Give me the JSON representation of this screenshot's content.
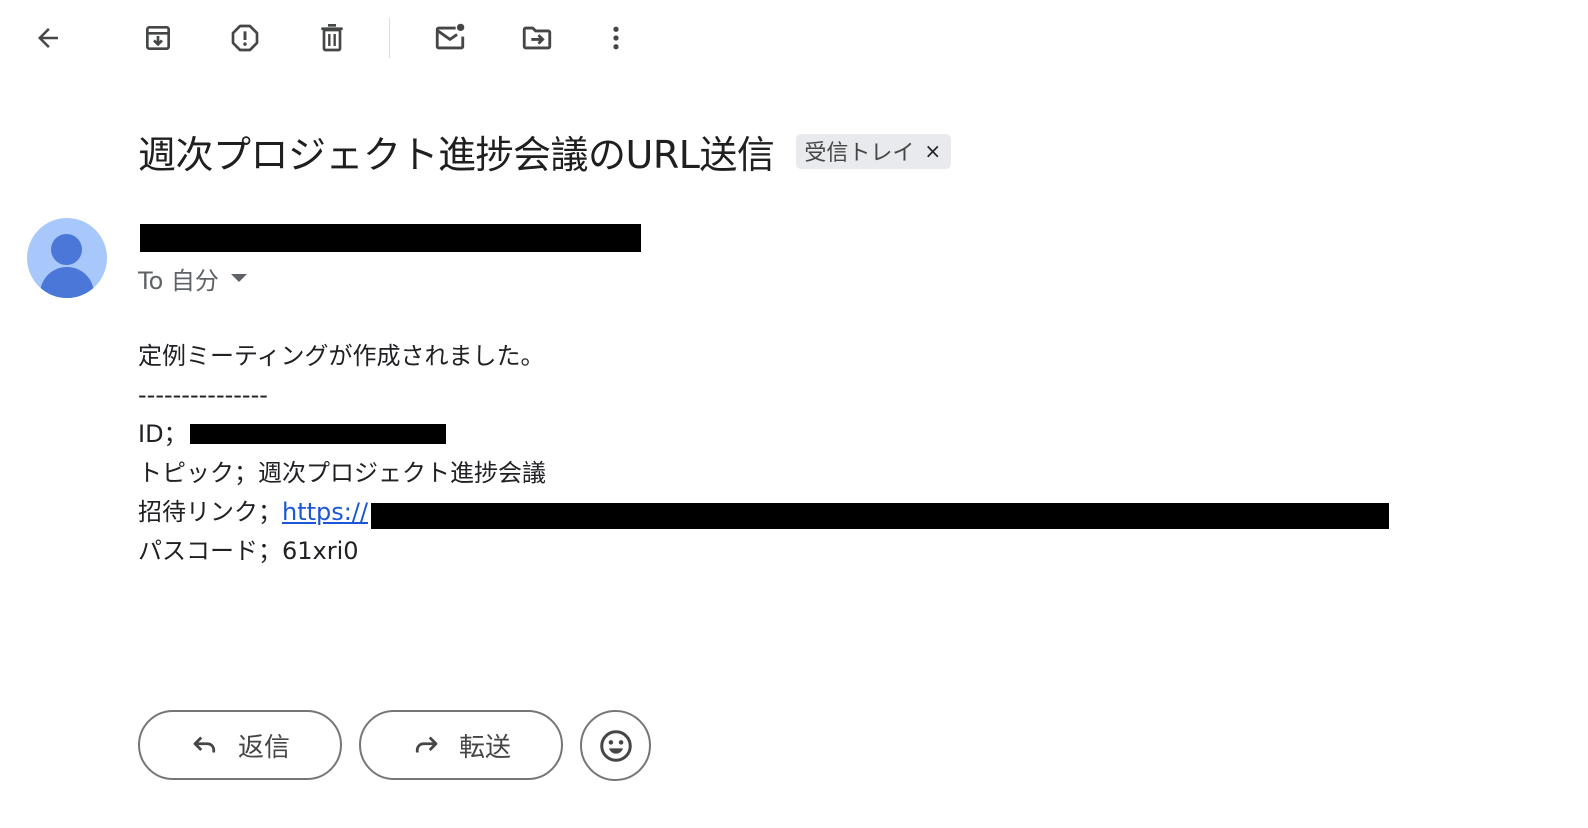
{
  "toolbar": {
    "icons": [
      "back-arrow-icon",
      "archive-icon",
      "report-spam-icon",
      "delete-icon",
      "mark-unread-icon",
      "move-to-icon",
      "more-vert-icon"
    ]
  },
  "email": {
    "subject": "週次プロジェクト進捗会議のURL送信",
    "label_chip": "受信トレイ",
    "label_chip_close": "×",
    "recipient": "To 自分",
    "body": {
      "line1": "定例ミーティングが作成されました。",
      "divider": "---------------",
      "id_label": "ID；",
      "topic": "トピック；週次プロジェクト進捗会議",
      "invite_label": "招待リンク；",
      "invite_link": "https://",
      "passcode": "パスコード；61xri0"
    }
  },
  "actions": {
    "reply_label": "返信",
    "forward_label": "転送"
  },
  "colors": {
    "link": "#1a56d6",
    "avatar_bg": "#a8c7fa",
    "avatar_fg": "#4b77d9",
    "chip_bg": "#e8eaed"
  }
}
